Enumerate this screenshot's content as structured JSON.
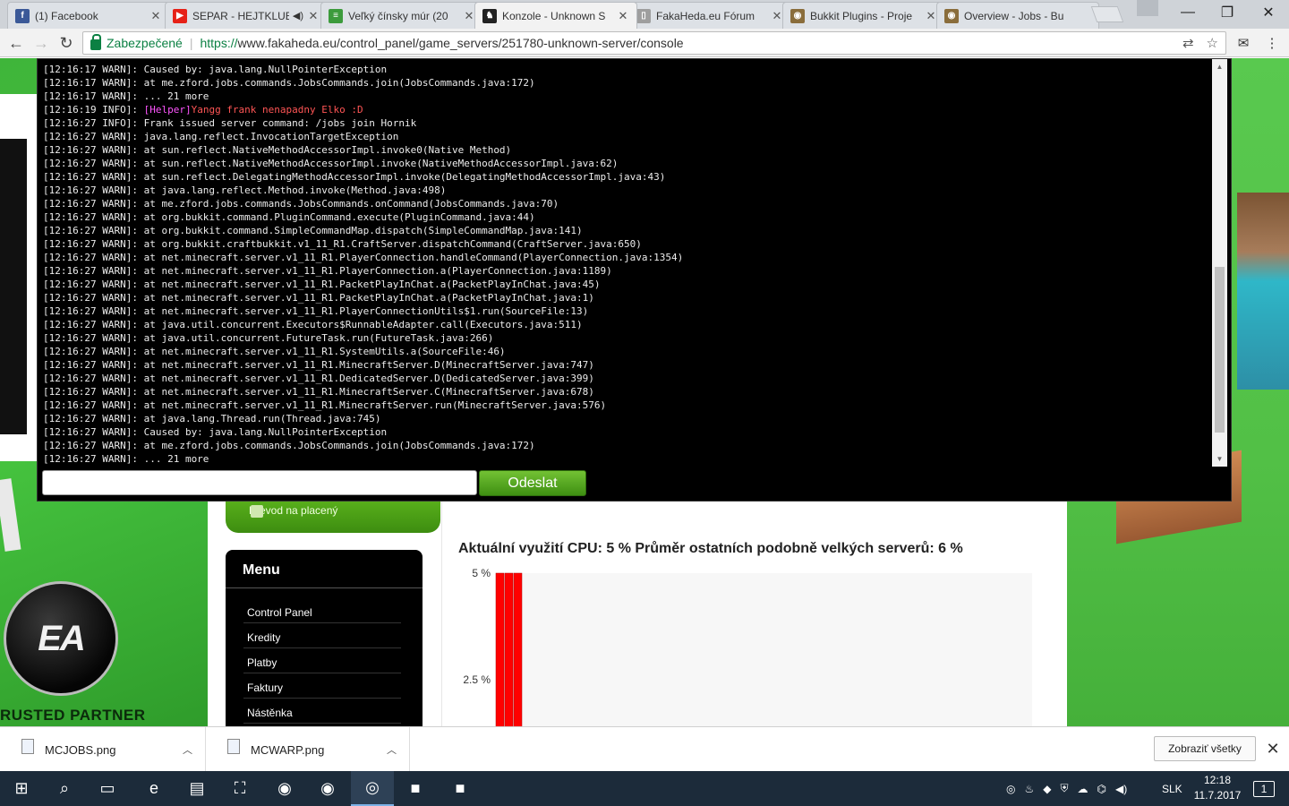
{
  "browser": {
    "tabs": [
      {
        "label": "(1) Facebook",
        "icon": "facebook-icon",
        "color": "#3b5998",
        "glyph": "f",
        "close": "✕"
      },
      {
        "label": "SEPAR - HEJTKLUB",
        "icon": "youtube-icon",
        "color": "#e62117",
        "glyph": "▶",
        "audio": "◀)",
        "close": "✕"
      },
      {
        "label": "Veľký čínsky múr (20",
        "icon": "document-icon",
        "color": "#3c9b3c",
        "glyph": "≡",
        "close": "✕"
      },
      {
        "label": "Konzole - Unknown S",
        "icon": "fakaheda-icon",
        "color": "#222222",
        "glyph": "♞",
        "close": "✕"
      },
      {
        "label": "FakaHeda.eu Fórum",
        "icon": "page-icon",
        "color": "#9e9e9e",
        "glyph": "▯",
        "close": "✕"
      },
      {
        "label": "Bukkit Plugins - Proje",
        "icon": "curse-icon",
        "color": "#8a6d3b",
        "glyph": "◉",
        "close": "✕"
      },
      {
        "label": "Overview - Jobs - Bu",
        "icon": "curse-icon",
        "color": "#8a6d3b",
        "glyph": "◉",
        "close": ""
      }
    ],
    "window_controls": {
      "minimize": "—",
      "maximize": "❐",
      "close": "✕"
    },
    "nav": {
      "back": "←",
      "forward": "→",
      "reload": "↻"
    },
    "address": {
      "secure_label": "Zabezpečené",
      "separator": "|",
      "scheme": "https://",
      "url": "www.fakaheda.eu/control_panel/game_servers/251780-unknown-server/console",
      "translate_icon": "⇄",
      "star_icon": "☆"
    },
    "extensions": {
      "mail": "✉",
      "menu": "⋮"
    }
  },
  "console": {
    "lines": [
      {
        "text": "[12:16:17 WARN]: Caused by: java.lang.NullPointerException"
      },
      {
        "text": "[12:16:17 WARN]: at me.zford.jobs.commands.JobsCommands.join(JobsCommands.java:172)"
      },
      {
        "text": "[12:16:17 WARN]: ... 21 more"
      },
      {
        "text": "[12:16:19 INFO]: ",
        "helper": "[Helper]",
        "chat": "Yangg frank nenapadny Elko :D"
      },
      {
        "text": "[12:16:27 INFO]: Frank issued server command: /jobs join Hornik"
      },
      {
        "text": "[12:16:27 WARN]: java.lang.reflect.InvocationTargetException"
      },
      {
        "text": "[12:16:27 WARN]: at sun.reflect.NativeMethodAccessorImpl.invoke0(Native Method)"
      },
      {
        "text": "[12:16:27 WARN]: at sun.reflect.NativeMethodAccessorImpl.invoke(NativeMethodAccessorImpl.java:62)"
      },
      {
        "text": "[12:16:27 WARN]: at sun.reflect.DelegatingMethodAccessorImpl.invoke(DelegatingMethodAccessorImpl.java:43)"
      },
      {
        "text": "[12:16:27 WARN]: at java.lang.reflect.Method.invoke(Method.java:498)"
      },
      {
        "text": "[12:16:27 WARN]: at me.zford.jobs.commands.JobsCommands.onCommand(JobsCommands.java:70)"
      },
      {
        "text": "[12:16:27 WARN]: at org.bukkit.command.PluginCommand.execute(PluginCommand.java:44)"
      },
      {
        "text": "[12:16:27 WARN]: at org.bukkit.command.SimpleCommandMap.dispatch(SimpleCommandMap.java:141)"
      },
      {
        "text": "[12:16:27 WARN]: at org.bukkit.craftbukkit.v1_11_R1.CraftServer.dispatchCommand(CraftServer.java:650)"
      },
      {
        "text": "[12:16:27 WARN]: at net.minecraft.server.v1_11_R1.PlayerConnection.handleCommand(PlayerConnection.java:1354)"
      },
      {
        "text": "[12:16:27 WARN]: at net.minecraft.server.v1_11_R1.PlayerConnection.a(PlayerConnection.java:1189)"
      },
      {
        "text": "[12:16:27 WARN]: at net.minecraft.server.v1_11_R1.PacketPlayInChat.a(PacketPlayInChat.java:45)"
      },
      {
        "text": "[12:16:27 WARN]: at net.minecraft.server.v1_11_R1.PacketPlayInChat.a(PacketPlayInChat.java:1)"
      },
      {
        "text": "[12:16:27 WARN]: at net.minecraft.server.v1_11_R1.PlayerConnectionUtils$1.run(SourceFile:13)"
      },
      {
        "text": "[12:16:27 WARN]: at java.util.concurrent.Executors$RunnableAdapter.call(Executors.java:511)"
      },
      {
        "text": "[12:16:27 WARN]: at java.util.concurrent.FutureTask.run(FutureTask.java:266)"
      },
      {
        "text": "[12:16:27 WARN]: at net.minecraft.server.v1_11_R1.SystemUtils.a(SourceFile:46)"
      },
      {
        "text": "[12:16:27 WARN]: at net.minecraft.server.v1_11_R1.MinecraftServer.D(MinecraftServer.java:747)"
      },
      {
        "text": "[12:16:27 WARN]: at net.minecraft.server.v1_11_R1.DedicatedServer.D(DedicatedServer.java:399)"
      },
      {
        "text": "[12:16:27 WARN]: at net.minecraft.server.v1_11_R1.MinecraftServer.C(MinecraftServer.java:678)"
      },
      {
        "text": "[12:16:27 WARN]: at net.minecraft.server.v1_11_R1.MinecraftServer.run(MinecraftServer.java:576)"
      },
      {
        "text": "[12:16:27 WARN]: at java.lang.Thread.run(Thread.java:745)"
      },
      {
        "text": "[12:16:27 WARN]: Caused by: java.lang.NullPointerException"
      },
      {
        "text": "[12:16:27 WARN]: at me.zford.jobs.commands.JobsCommands.join(JobsCommands.java:172)"
      },
      {
        "text": "[12:16:27 WARN]: ... 21 more"
      }
    ],
    "input_value": "",
    "send_label": "Odeslat",
    "colors": {
      "helper_tag": "#ff55ff",
      "chat_text": "#ff5555",
      "send_button": "#4ea41c"
    },
    "scroll_up": "▲",
    "scroll_down": "▼"
  },
  "sidebar": {
    "convert_label": "Převod na placený",
    "menu_title": "Menu",
    "menu_items": [
      "Control Panel",
      "Kredity",
      "Platby",
      "Faktury",
      "Nástěnka"
    ]
  },
  "cpu": {
    "title": "Aktuální využití CPU: 5 % Průměr ostatních podobně velkých serverů: 6 %"
  },
  "chart_data": {
    "type": "bar",
    "title": "",
    "ytick_labels": [
      "5 %",
      "2.5 %"
    ],
    "ylim": [
      0,
      5
    ],
    "series": [
      {
        "values": [
          5,
          5,
          5
        ],
        "color": "#ff0000"
      }
    ],
    "grid": false
  },
  "ads": {
    "partner_text": "RUSTED PARTNER",
    "ea_logo": "EA"
  },
  "downloads": {
    "items": [
      {
        "name": "MCJOBS.png",
        "chevron": "︿"
      },
      {
        "name": "MCWARP.png",
        "chevron": "︿"
      }
    ],
    "show_all": "Zobraziť všetky",
    "close": "✕"
  },
  "taskbar": {
    "apps": [
      {
        "name": "start-button",
        "glyph": "⊞"
      },
      {
        "name": "search-icon",
        "glyph": "⌕"
      },
      {
        "name": "task-view-icon",
        "glyph": "▭"
      },
      {
        "name": "edge-icon",
        "glyph": "e"
      },
      {
        "name": "file-explorer-icon",
        "glyph": "▤"
      },
      {
        "name": "store-icon",
        "glyph": "⛶"
      },
      {
        "name": "firefox-icon",
        "glyph": "◉"
      },
      {
        "name": "firefox-dev-icon",
        "glyph": "◉"
      },
      {
        "name": "chrome-icon",
        "glyph": "◎"
      },
      {
        "name": "minecraft-icon",
        "glyph": "■"
      },
      {
        "name": "minecraft-server-icon",
        "glyph": "■"
      }
    ],
    "tray_icons": [
      "◎",
      "♨",
      "◆",
      "⛨",
      "☁",
      "⌬",
      "◀)"
    ],
    "language": "SLK",
    "time": "12:18",
    "date": "11.7.2017",
    "notification": "1"
  }
}
